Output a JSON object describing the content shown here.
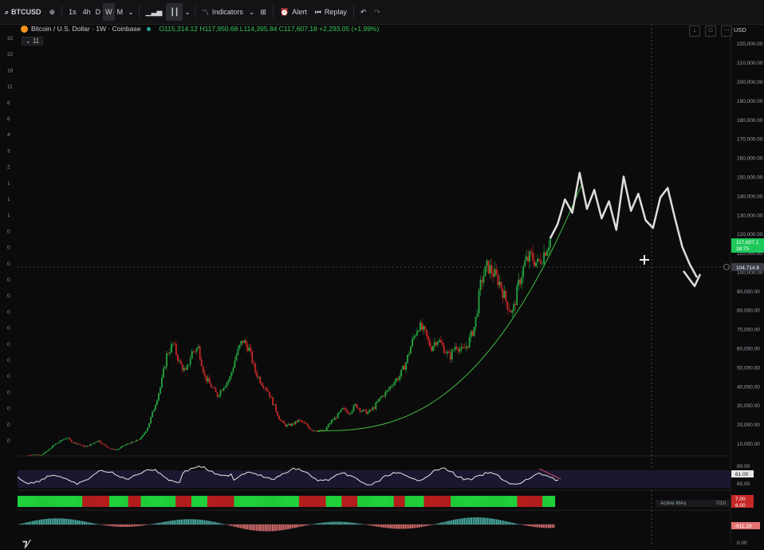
{
  "toolbar": {
    "symbol": "BTCUSD",
    "intervals": [
      "1s",
      "4h",
      "D",
      "W",
      "M"
    ],
    "active_interval": "W",
    "indicators_label": "Indicators",
    "alert_label": "Alert",
    "replay_label": "Replay"
  },
  "legend": {
    "title": "Bitcoin / U.S. Dollar · 1W · Coinbase",
    "ohlc": "O115,314.12 H117,950.68 L114,395.84 C117,607.18 +2,293.05 (+1.99%)",
    "indicator_count": "11"
  },
  "price_axis": {
    "currency": "USD",
    "labels": [
      "220,000.00",
      "210,000.00",
      "200,000.00",
      "190,000.00",
      "180,000.00",
      "170,000.00",
      "160,000.00",
      "150,000.00",
      "140,000.00",
      "130,000.00",
      "120,000.00",
      "110,000.00",
      "100,000.00",
      "90,000.00",
      "80,000.00",
      "70,000.00",
      "60,000.00",
      "50,000.00",
      "40,000.00",
      "30,000.00",
      "20,000.00",
      "10,000.00"
    ],
    "last_price": "117,607.1",
    "last_sub": "38:75",
    "crosshair_price": "104,714.9"
  },
  "left_axis_labels": [
    "32",
    "22",
    "16",
    "11",
    "8",
    "6",
    "4",
    "3",
    "2",
    "1",
    "1",
    "1",
    "0",
    "0",
    "0",
    "0",
    "0",
    "0",
    "0",
    "0",
    "0",
    "0",
    "0",
    "0",
    "0",
    "0"
  ],
  "rsi_axis": {
    "top": "80.00",
    "value": "61.00",
    "bottom": "60.00"
  },
  "ma_axis": {
    "v1": "7.00",
    "v2": "6.00"
  },
  "active_mas": {
    "label": "Active MAs",
    "value": "7/10"
  },
  "macd_axis": {
    "value": "-611.29",
    "bottom": "0.00"
  },
  "colors": {
    "up": "#26a641",
    "down": "#c62828",
    "bg": "#0b0b0c",
    "projection": "#dddddd",
    "curve": "#3fbf3f",
    "last_price": "#1ec85b"
  },
  "chart_data": {
    "type": "candlestick",
    "title": "Bitcoin / U.S. Dollar · 1W · Coinbase",
    "ylim": [
      10000,
      225000
    ],
    "approx_close_path": [
      3800,
      4000,
      3900,
      6000,
      9000,
      11000,
      13000,
      10500,
      9500,
      8000,
      9500,
      11500,
      9000,
      7000,
      6500,
      8500,
      10000,
      11000,
      13000,
      19000,
      29000,
      40000,
      57000,
      62000,
      52000,
      47000,
      58000,
      60000,
      45000,
      40000,
      35000,
      40000,
      44000,
      56000,
      64000,
      60000,
      48000,
      42000,
      38000,
      30000,
      22000,
      19000,
      20000,
      22000,
      20000,
      17000,
      16500,
      16000,
      21000,
      24000,
      28000,
      26000,
      30000,
      27000,
      26000,
      29000,
      34000,
      37000,
      42000,
      45000,
      52000,
      63000,
      72000,
      68000,
      60000,
      65000,
      60000,
      55000,
      62000,
      58000,
      63000,
      72000,
      95000,
      103000,
      99000,
      94000,
      84000,
      78000,
      94000,
      105000,
      108000,
      104000,
      110000,
      117607
    ],
    "projection_path": [
      117607,
      125000,
      138000,
      131000,
      152000,
      133000,
      143000,
      128000,
      137000,
      122000,
      150000,
      132000,
      141000,
      127000,
      123000,
      139000,
      144000,
      128000,
      113000,
      104000,
      97000
    ],
    "curve": "parabolic support from 2022 low to current"
  }
}
